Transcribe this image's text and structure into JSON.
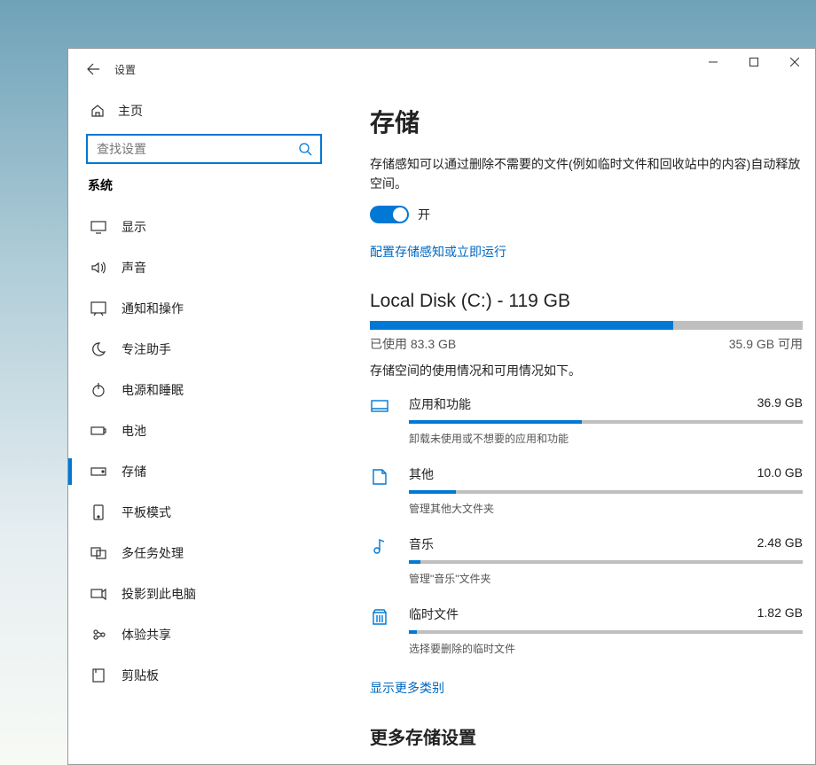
{
  "app_title": "设置",
  "window_controls": {
    "min": "–",
    "max": "□",
    "close": "×"
  },
  "sidebar": {
    "home_label": "主页",
    "search_placeholder": "查找设置",
    "section_label": "系统",
    "items": [
      {
        "label": "显示"
      },
      {
        "label": "声音"
      },
      {
        "label": "通知和操作"
      },
      {
        "label": "专注助手"
      },
      {
        "label": "电源和睡眠"
      },
      {
        "label": "电池"
      },
      {
        "label": "存储",
        "active": true
      },
      {
        "label": "平板模式"
      },
      {
        "label": "多任务处理"
      },
      {
        "label": "投影到此电脑"
      },
      {
        "label": "体验共享"
      },
      {
        "label": "剪贴板"
      }
    ]
  },
  "content": {
    "page_title": "存储",
    "sense_desc": "存储感知可以通过删除不需要的文件(例如临时文件和回收站中的内容)自动释放空间。",
    "toggle_state": "开",
    "config_link": "配置存储感知或立即运行",
    "disk": {
      "title": "Local Disk (C:) - 119 GB",
      "used_label": "已使用 83.3 GB",
      "free_label": "35.9 GB 可用",
      "used_pct": 70
    },
    "usage_desc": "存储空间的使用情况和可用情况如下。",
    "categories": [
      {
        "name": "应用和功能",
        "size": "36.9 GB",
        "tip": "卸载未使用或不想要的应用和功能",
        "pct": 44
      },
      {
        "name": "其他",
        "size": "10.0 GB",
        "tip": "管理其他大文件夹",
        "pct": 12
      },
      {
        "name": "音乐",
        "size": "2.48 GB",
        "tip": "管理\"音乐\"文件夹",
        "pct": 3
      },
      {
        "name": "临时文件",
        "size": "1.82 GB",
        "tip": "选择要删除的临时文件",
        "pct": 2
      }
    ],
    "more_link": "显示更多类别",
    "more_heading": "更多存储设置"
  }
}
